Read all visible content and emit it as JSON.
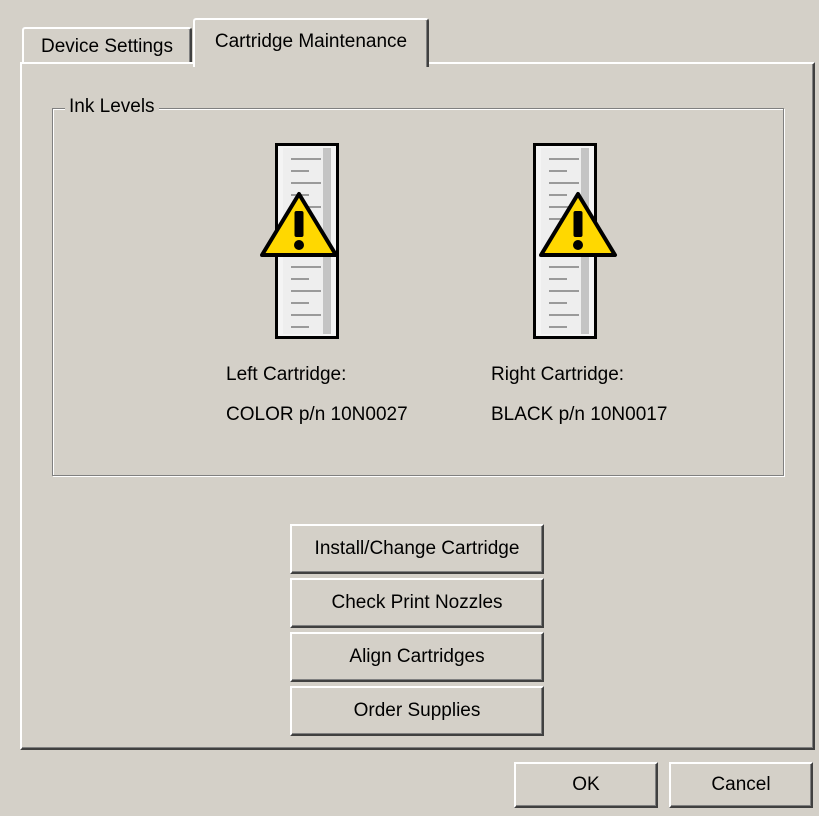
{
  "tabs": [
    {
      "label": "Device Settings",
      "active": false
    },
    {
      "label": "Cartridge Maintenance",
      "active": true
    }
  ],
  "ink_levels": {
    "title": "Ink Levels",
    "left": {
      "label": "Left Cartridge:",
      "part": "COLOR p/n 10N0027",
      "status_icon": "warning-icon"
    },
    "right": {
      "label": "Right Cartridge:",
      "part": "BLACK p/n 10N0017",
      "status_icon": "warning-icon"
    }
  },
  "actions": {
    "install": "Install/Change Cartridge",
    "check_nozzles": "Check Print Nozzles",
    "align": "Align Cartridges",
    "order": "Order Supplies"
  },
  "dialog": {
    "ok": "OK",
    "cancel": "Cancel"
  },
  "colors": {
    "face": "#d4d0c8",
    "warning": "#ffd800",
    "text": "#000000"
  }
}
